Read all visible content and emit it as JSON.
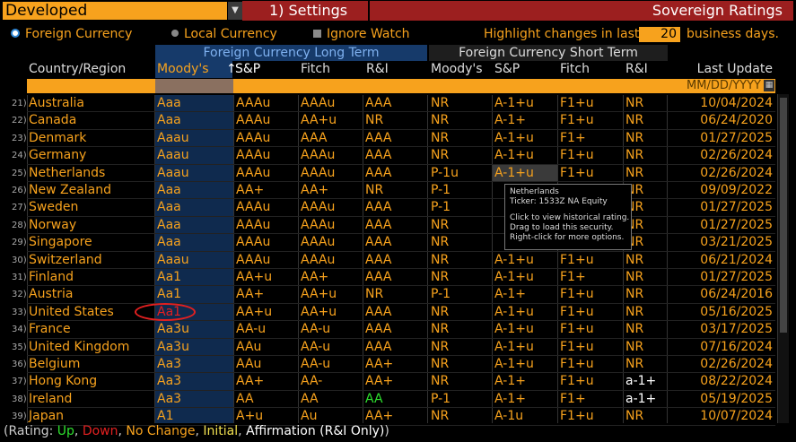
{
  "topbar": {
    "dropdown_value": "Developed",
    "settings_label": "1) Settings",
    "screen_title": "Sovereign Ratings"
  },
  "options": {
    "foreign_currency": "Foreign Currency",
    "local_currency": "Local Currency",
    "ignore_watch": "Ignore Watch",
    "highlight_prefix": "Highlight changes in last",
    "days_value": "20",
    "highlight_suffix": "business days."
  },
  "groups": {
    "long_term": "Foreign Currency Long Term",
    "short_term": "Foreign Currency Short Term"
  },
  "columns": {
    "country": "Country/Region",
    "moodys": "Moody's",
    "sort_arrow": "↑",
    "sp": "S&P",
    "fitch": "Fitch",
    "ri": "R&I",
    "st_moodys": "Moody's",
    "st_sp": "S&P",
    "st_fitch": "Fitch",
    "st_ri": "R&I",
    "last_update": "Last Update"
  },
  "filter": {
    "date_placeholder": "MM/DD/YYYY"
  },
  "rows": [
    {
      "n": "21)",
      "country": "Australia",
      "m": "Aaa",
      "s": "AAAu",
      "f": "AAAu",
      "r": "AAA",
      "sm": "NR",
      "ss": "A-1+u",
      "sf": "F1+u",
      "sr": "NR",
      "d": "10/04/2024"
    },
    {
      "n": "22)",
      "country": "Canada",
      "m": "Aaa",
      "s": "AAAu",
      "f": "AA+u",
      "r": "NR",
      "sm": "NR",
      "ss": "A-1+",
      "sf": "F1+u",
      "sr": "NR",
      "d": "06/24/2020"
    },
    {
      "n": "23)",
      "country": "Denmark",
      "m": "Aaau",
      "s": "AAAu",
      "f": "AAA",
      "r": "AAA",
      "sm": "NR",
      "ss": "A-1+u",
      "sf": "F1+",
      "sr": "NR",
      "d": "01/27/2025"
    },
    {
      "n": "24)",
      "country": "Germany",
      "m": "Aaau",
      "s": "AAAu",
      "f": "AAAu",
      "r": "AAA",
      "sm": "NR",
      "ss": "A-1+u",
      "sf": "F1+u",
      "sr": "NR",
      "d": "02/26/2024"
    },
    {
      "n": "25)",
      "country": "Netherlands",
      "m": "Aaau",
      "s": "AAAu",
      "f": "AAAu",
      "r": "AAA",
      "sm": "P-1u",
      "ss": "A-1+u",
      "sf": "F1+u",
      "sr": "NR",
      "d": "02/26/2024"
    },
    {
      "n": "26)",
      "country": "New Zealand",
      "m": "Aaa",
      "s": "AA+",
      "f": "AA+",
      "r": "NR",
      "sm": "P-1",
      "ss": "",
      "sf": "",
      "sr": "NR",
      "d": "09/09/2022"
    },
    {
      "n": "27)",
      "country": "Sweden",
      "m": "Aaa",
      "s": "AAAu",
      "f": "AAAu",
      "r": "AAA",
      "sm": "P-1",
      "ss": "",
      "sf": "",
      "sr": "NR",
      "d": "01/27/2025"
    },
    {
      "n": "28)",
      "country": "Norway",
      "m": "Aaa",
      "s": "AAAu",
      "f": "AAAu",
      "r": "AAA",
      "sm": "NR",
      "ss": "",
      "sf": "",
      "sr": "NR",
      "d": "01/27/2025"
    },
    {
      "n": "29)",
      "country": "Singapore",
      "m": "Aaa",
      "s": "AAAu",
      "f": "AAAu",
      "r": "AAA",
      "sm": "NR",
      "ss": "",
      "sf": "",
      "sr": "NR",
      "d": "03/21/2025"
    },
    {
      "n": "30)",
      "country": "Switzerland",
      "m": "Aaau",
      "s": "AAAu",
      "f": "AAAu",
      "r": "AAA",
      "sm": "NR",
      "ss": "A-1+u",
      "sf": "F1+u",
      "sr": "NR",
      "d": "06/21/2024"
    },
    {
      "n": "31)",
      "country": "Finland",
      "m": "Aa1",
      "s": "AA+u",
      "f": "AA+",
      "r": "AAA",
      "sm": "NR",
      "ss": "A-1+u",
      "sf": "F1+",
      "sr": "NR",
      "d": "01/27/2025"
    },
    {
      "n": "32)",
      "country": "Austria",
      "m": "Aa1",
      "s": "AA+",
      "f": "AA+u",
      "r": "NR",
      "sm": "P-1",
      "ss": "A-1+",
      "sf": "F1+u",
      "sr": "NR",
      "d": "06/24/2016"
    },
    {
      "n": "33)",
      "country": "United States",
      "m": "Aa1",
      "s": "AA+u",
      "f": "AA+u",
      "r": "AAA",
      "sm": "NR",
      "ss": "A-1+u",
      "sf": "F1+u",
      "sr": "NR",
      "d": "05/16/2025"
    },
    {
      "n": "34)",
      "country": "France",
      "m": "Aa3u",
      "s": "AA-u",
      "f": "AA-u",
      "r": "AAA",
      "sm": "NR",
      "ss": "A-1+u",
      "sf": "F1+u",
      "sr": "NR",
      "d": "03/17/2025"
    },
    {
      "n": "35)",
      "country": "United Kingdom",
      "m": "Aa3u",
      "s": "AAu",
      "f": "AA-u",
      "r": "AAA",
      "sm": "NR",
      "ss": "A-1+u",
      "sf": "F1+u",
      "sr": "NR",
      "d": "07/16/2024"
    },
    {
      "n": "36)",
      "country": "Belgium",
      "m": "Aa3",
      "s": "AAu",
      "f": "AA-u",
      "r": "AA+",
      "sm": "NR",
      "ss": "A-1+u",
      "sf": "F1+u",
      "sr": "NR",
      "d": "02/26/2024"
    },
    {
      "n": "37)",
      "country": "Hong Kong",
      "m": "Aa3",
      "s": "AA+",
      "f": "AA-",
      "r": "AA+",
      "sm": "NR",
      "ss": "A-1+",
      "sf": "F1+u",
      "sr": "a-1+",
      "d": "08/22/2024"
    },
    {
      "n": "38)",
      "country": "Ireland",
      "m": "Aa3",
      "s": "AA",
      "f": "AA",
      "r": "AA",
      "sm": "P-1",
      "ss": "A-1+",
      "sf": "F1+",
      "sr": "a-1+",
      "d": "05/19/2025"
    },
    {
      "n": "39)",
      "country": "Japan",
      "m": "A1",
      "s": "A+u",
      "f": "Au",
      "r": "AA+",
      "sm": "NR",
      "ss": "A-1u",
      "sf": "F1+u",
      "sr": "NR",
      "d": "10/07/2024"
    }
  ],
  "tooltip": {
    "line1": "Netherlands",
    "line2": "Ticker: 1533Z NA Equity",
    "line3": "Click to view historical rating.",
    "line4": "Drag to load this security.",
    "line5": "Right-click for more options."
  },
  "legend": {
    "open": "(Rating: ",
    "up": "Up",
    "comma1": ", ",
    "down": "Down",
    "comma2": ", ",
    "no_change": "No Change",
    "comma3": ", ",
    "initial": "Initial",
    "comma4": ", ",
    "affirmation": "Affirmation (R&I Only)",
    "close": ")"
  },
  "colors": {
    "accent": "#f7a21d",
    "header_red": "#9c1f1f",
    "up": "#2ee02e",
    "down": "#e32020",
    "initial": "#f0e050",
    "selected_col": "#0f2a4e"
  }
}
